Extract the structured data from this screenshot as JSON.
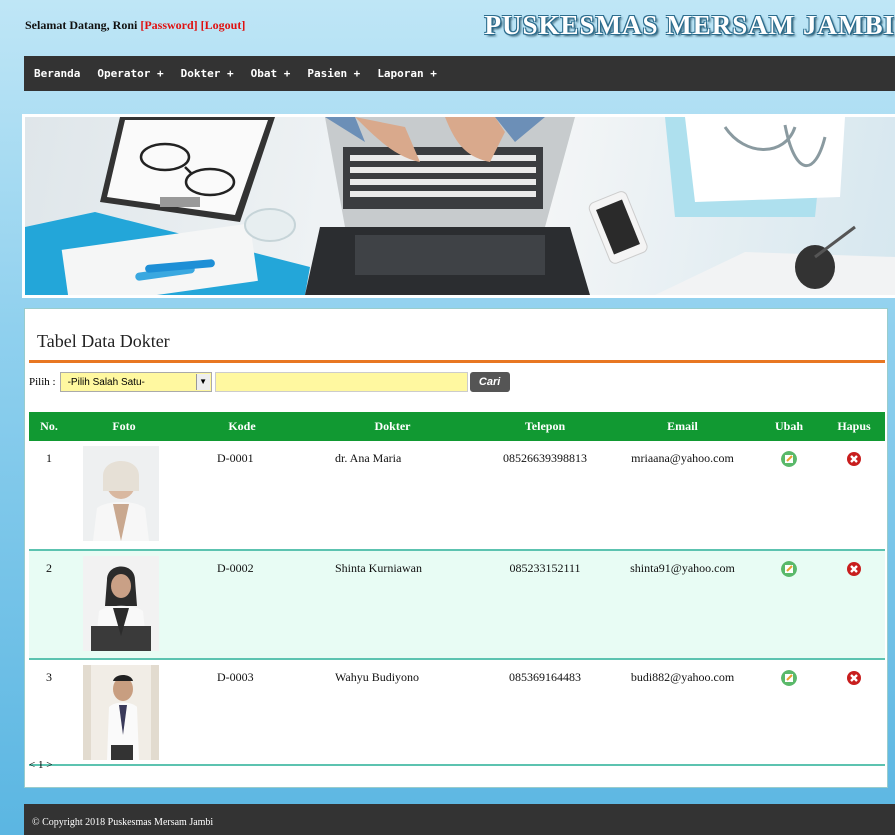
{
  "header": {
    "welcome_prefix": "Selamat Datang, Roni",
    "password_link": "[Password]",
    "logout_link": "[Logout]",
    "site_title": "PUSKESMAS MERSAM JAMBI"
  },
  "nav": [
    "Beranda",
    "Operator +",
    "Dokter +",
    "Obat +",
    "Pasien +",
    "Laporan +"
  ],
  "panel": {
    "title": "Tabel Data Dokter",
    "filter_label": "Pilih :",
    "select_value": "-Pilih Salah Satu-",
    "search_value": "",
    "search_button": "Cari"
  },
  "table": {
    "headers": [
      "No.",
      "Foto",
      "Kode",
      "Dokter",
      "Telepon",
      "Email",
      "Ubah",
      "Hapus"
    ],
    "rows": [
      {
        "no": "1",
        "kode": "D-0001",
        "dokter": "dr. Ana Maria",
        "telepon": "08526639398813",
        "email": "mriaana@yahoo.com"
      },
      {
        "no": "2",
        "kode": "D-0002",
        "dokter": "Shinta Kurniawan",
        "telepon": "085233152111",
        "email": "shinta91@yahoo.com"
      },
      {
        "no": "3",
        "kode": "D-0003",
        "dokter": "Wahyu Budiyono",
        "telepon": "085369164483",
        "email": "budi882@yahoo.com"
      }
    ]
  },
  "pagination": "< 1 >",
  "footer": "© Copyright 2018 Puskesmas Mersam Jambi",
  "colors": {
    "accent": "#119932",
    "rule": "#e87722",
    "nav": "#333333",
    "link": "#e01010"
  },
  "icons": {
    "edit": "edit-icon",
    "delete": "delete-icon"
  }
}
